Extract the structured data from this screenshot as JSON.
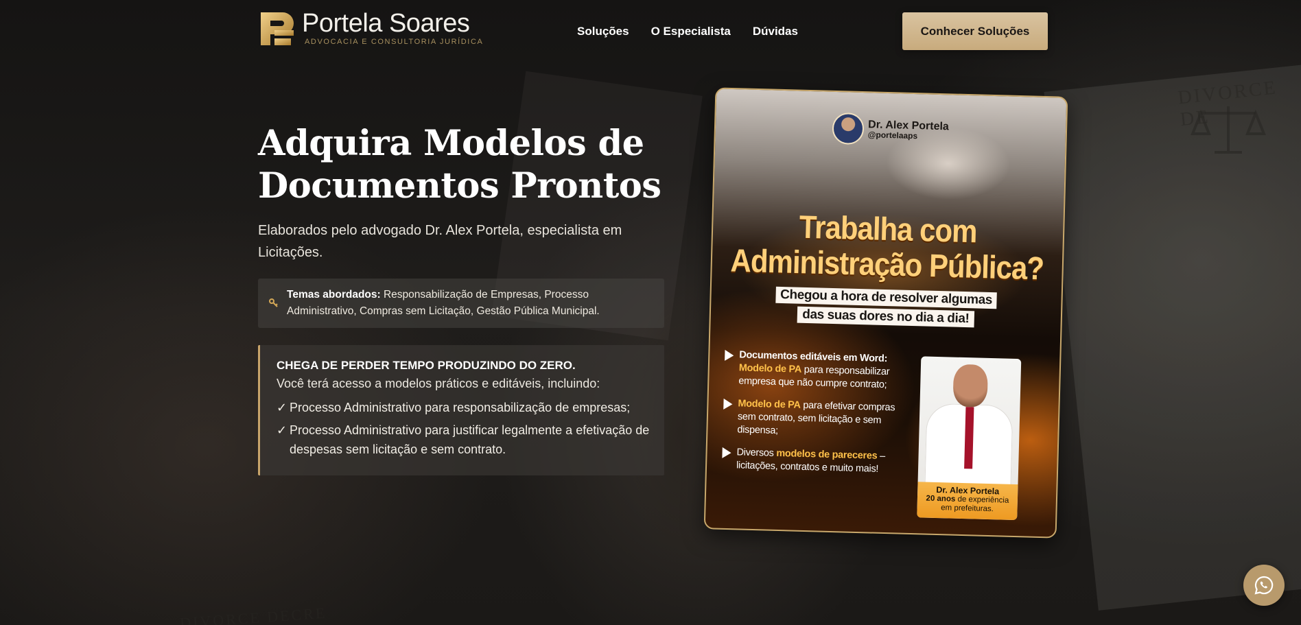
{
  "brand": {
    "name": "Portela Soares",
    "tagline": "ADVOCACIA E CONSULTORIA JURÍDICA",
    "gold": "#c8a46a"
  },
  "nav": {
    "items": [
      "Soluções",
      "O Especialista",
      "Dúvidas"
    ],
    "cta_label": "Conhecer Soluções"
  },
  "hero": {
    "title_line1": "Adquira Modelos de",
    "title_line2": "Documentos Prontos",
    "subtitle": "Elaborados pelo advogado Dr. Alex Portela, especialista em Licitações."
  },
  "topics": {
    "icon": "key-icon",
    "label": "Temas abordados:",
    "text": "Responsabilização de Empresas, Processo Administrativo, Compras sem Licitação, Gestão Pública Municipal."
  },
  "benefits": {
    "title": "CHEGA DE PERDER TEMPO PRODUZINDO DO ZERO.",
    "intro": "Você terá acesso a modelos práticos e editáveis, incluindo:",
    "check": "✓",
    "items": [
      "Processo Administrativo para responsabilização de empresas;",
      "Processo Administrativo para justificar legalmente a efetivação de despesas sem licitação e sem contrato."
    ]
  },
  "promo": {
    "author_name": "Dr. Alex Portela",
    "author_handle": "@portelaaps",
    "headline_line1": "Trabalha com",
    "headline_line2": "Administração Pública?",
    "pill_line1": "Chegou a hora de resolver algumas",
    "pill_line2": "das suas dores no dia a dia!",
    "item1_bold": "Documentos editáveis em Word:",
    "item1_gold": "Modelo de PA",
    "item1_rest": " para responsabilizar empresa que não cumpre contrato;",
    "item2_gold": "Modelo de PA",
    "item2_rest": " para efetivar compras sem contrato, sem licitação e sem dispensa;",
    "item3_pre": "Diversos ",
    "item3_gold": "modelos de pareceres",
    "item3_rest": " – licitações, contratos e muito mais!",
    "caption_name": "Dr. Alex Portela",
    "caption_years": "20 anos",
    "caption_line2": " de experiência",
    "caption_line3": "em prefeituras."
  },
  "whatsapp": {
    "icon": "whatsapp-icon"
  },
  "background": {
    "doc_text_1": "DIVORCE DE",
    "doc_text_2": "DIVORCE DECRE"
  }
}
